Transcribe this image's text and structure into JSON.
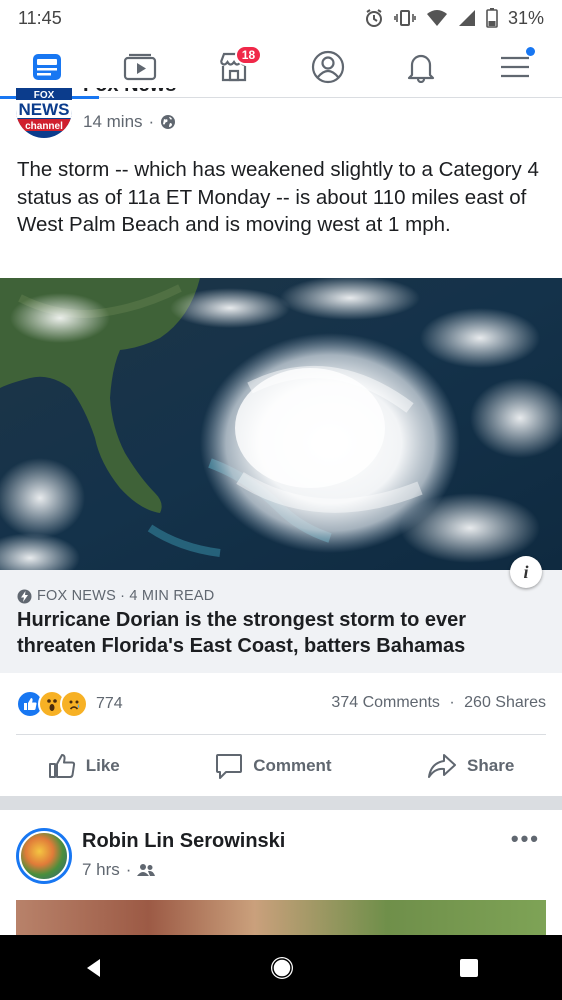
{
  "status_bar": {
    "time": "11:45",
    "battery": "31%"
  },
  "nav": {
    "marketplace_badge": "18"
  },
  "post1": {
    "page_name": "Fox News",
    "time": "14 mins",
    "separator": "·",
    "body": "The storm -- which has weakened slightly to a Category 4 status as of 11a ET Monday -- is about 110 miles east of West Palm Beach and is moving west at 1 mph.",
    "link": {
      "source": "FOX NEWS · 4 MIN READ",
      "title": "Hurricane Dorian is the strongest storm to ever threaten Florida's East Coast, batters Bahamas",
      "info_label": "i"
    },
    "reaction_count": "774",
    "comments": "374 Comments",
    "shares": "260 Shares",
    "counts_separator": "·",
    "actions": {
      "like": "Like",
      "comment": "Comment",
      "share": "Share"
    }
  },
  "post2": {
    "name": "Robin Lin Serowinski",
    "time": "7 hrs",
    "separator": "·",
    "more": "•••"
  },
  "logo": {
    "line1": "FOX",
    "line2": "NEWS",
    "line3": "channel"
  },
  "colors": {
    "brand_blue": "#1877f2",
    "badge_red": "#f02849",
    "text_secondary": "#606770"
  }
}
